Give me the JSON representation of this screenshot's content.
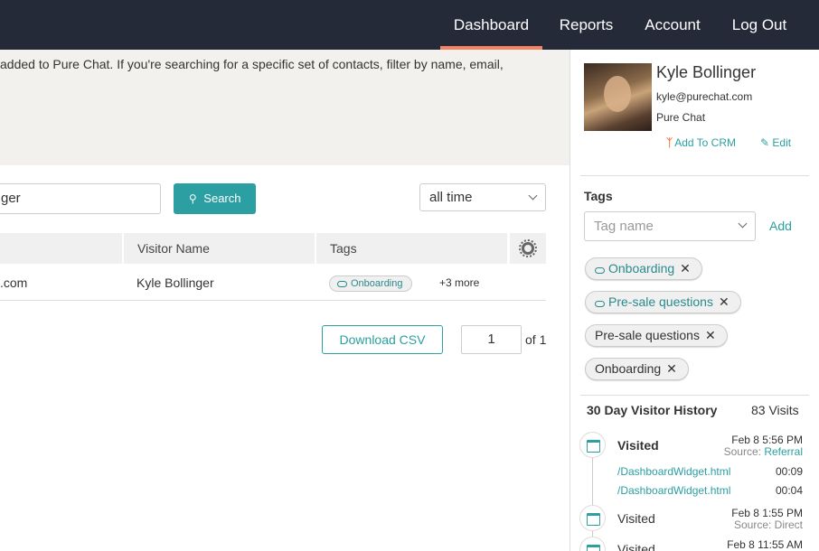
{
  "nav": {
    "items": [
      "Dashboard",
      "Reports",
      "Account",
      "Log Out"
    ],
    "active": "Dashboard",
    "accent_color": "#f48363"
  },
  "banner": {
    "text": "added to Pure Chat. If you're searching for a specific set of contacts, filter by name, email,"
  },
  "search": {
    "value": "ger",
    "button_label": "Search",
    "button_icon": "search-icon",
    "time_filter": "all time"
  },
  "table": {
    "headers": [
      "Visitor Name",
      "Tags"
    ],
    "settings_icon": "gear-icon",
    "rows": [
      {
        "email": ".com",
        "name": "Kyle Bollinger",
        "tag": "Onboarding",
        "more": "+3 more"
      }
    ]
  },
  "footer": {
    "csv_label": "Download CSV",
    "page": "1",
    "of_label": "of 1"
  },
  "profile": {
    "name": "Kyle Bollinger",
    "email": "kyle@purechat.com",
    "company": "Pure Chat",
    "crm_label": "Add To CRM",
    "edit_label": "Edit"
  },
  "tags": {
    "title": "Tags",
    "placeholder": "Tag name",
    "add_label": "Add",
    "items": [
      "Onboarding",
      "Pre-sale questions",
      "Pre-sale questions",
      "Onboarding"
    ],
    "remove_glyph": "✕"
  },
  "history": {
    "title": "30 Day Visitor History",
    "count": "83 Visits",
    "visits": [
      {
        "label": "Visited",
        "date": "Feb 8 5:56 PM",
        "source_prefix": "Source: ",
        "source": "Referral",
        "pages": [
          {
            "path": "/DashboardWidget.html",
            "duration": "00:09"
          },
          {
            "path": "/DashboardWidget.html",
            "duration": "00:04"
          }
        ]
      },
      {
        "label": "Visited",
        "date": "Feb 8 1:55 PM",
        "source": "Source: Direct"
      },
      {
        "label": "Visited",
        "date": "Feb 8 11:55 AM"
      }
    ]
  }
}
